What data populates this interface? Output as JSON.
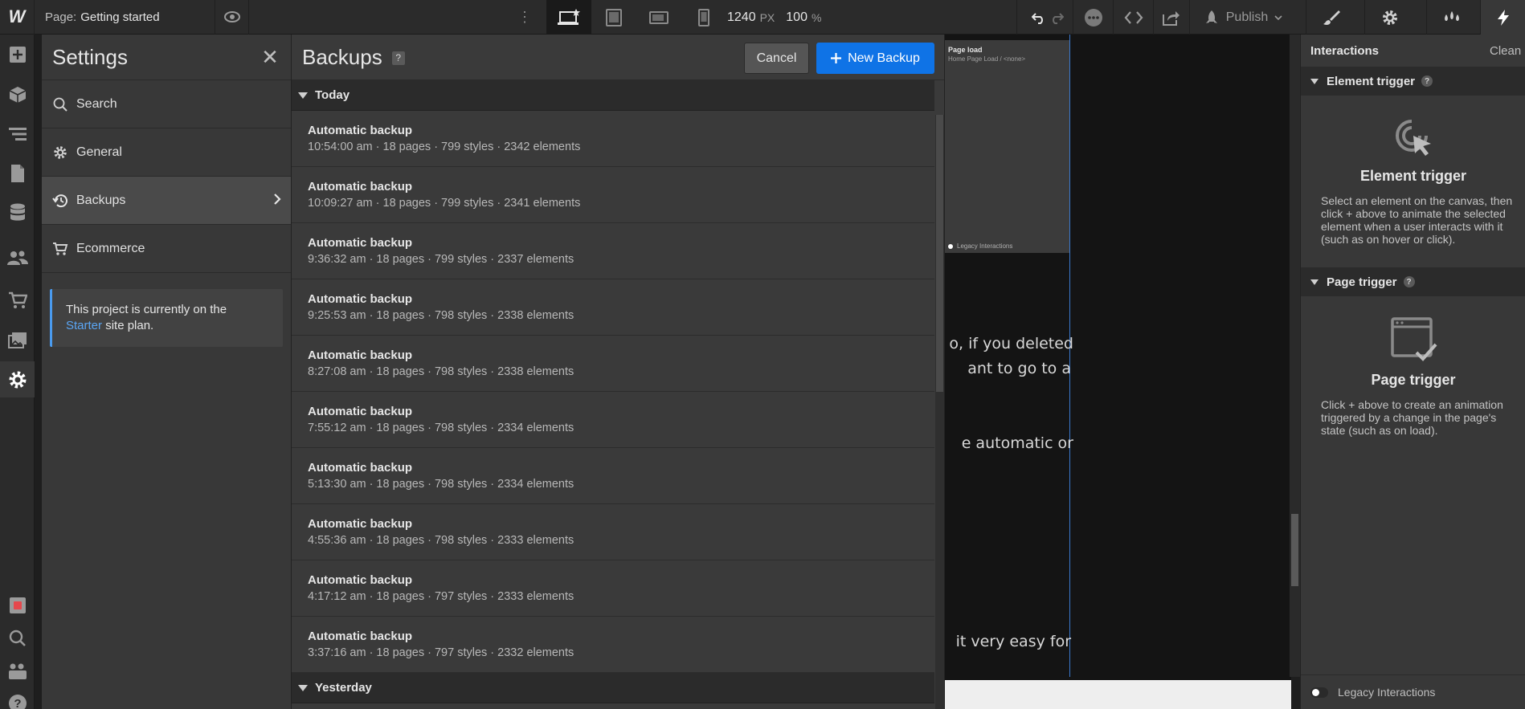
{
  "topbar": {
    "logo": "W",
    "page_label": "Page:",
    "page_name": "Getting started",
    "width_value": "1240",
    "width_unit": "PX",
    "zoom_value": "100",
    "zoom_unit": "%",
    "publish_label": "Publish",
    "accent_active": "#1a1a1a"
  },
  "rail": {
    "items": [
      "add-icon",
      "box-icon",
      "navigator-icon",
      "pages-icon",
      "cms-icon",
      "users-icon",
      "ecommerce-icon",
      "assets-icon",
      "settings-icon"
    ],
    "bottom": [
      "record-icon",
      "search-icon",
      "team-icon",
      "help-icon"
    ]
  },
  "settings": {
    "title": "Settings",
    "items": [
      {
        "label": "Search",
        "icon": "search-icon"
      },
      {
        "label": "General",
        "icon": "gear-icon"
      },
      {
        "label": "Backups",
        "icon": "history-icon"
      },
      {
        "label": "Ecommerce",
        "icon": "cart-icon"
      }
    ],
    "plan_text_1": "This project is currently on the",
    "plan_link": "Starter",
    "plan_text_2": "site plan."
  },
  "backups": {
    "title": "Backups",
    "help": "?",
    "cancel_label": "Cancel",
    "new_label": "New Backup",
    "groups": [
      {
        "label": "Today",
        "rows": [
          {
            "name": "Automatic backup",
            "meta": "10:54:00 am · 18 pages · 799 styles · 2342 elements"
          },
          {
            "name": "Automatic backup",
            "meta": "10:09:27 am · 18 pages · 799 styles · 2341 elements"
          },
          {
            "name": "Automatic backup",
            "meta": "9:36:32 am · 18 pages · 799 styles · 2337 elements"
          },
          {
            "name": "Automatic backup",
            "meta": "9:25:53 am · 18 pages · 798 styles · 2338 elements"
          },
          {
            "name": "Automatic backup",
            "meta": "8:27:08 am · 18 pages · 798 styles · 2338 elements"
          },
          {
            "name": "Automatic backup",
            "meta": "7:55:12 am · 18 pages · 798 styles · 2334 elements"
          },
          {
            "name": "Automatic backup",
            "meta": "5:13:30 am · 18 pages · 798 styles · 2334 elements"
          },
          {
            "name": "Automatic backup",
            "meta": "4:55:36 am · 18 pages · 798 styles · 2333 elements"
          },
          {
            "name": "Automatic backup",
            "meta": "4:17:12 am · 18 pages · 797 styles · 2333 elements"
          },
          {
            "name": "Automatic backup",
            "meta": "3:37:16 am · 18 pages · 797 styles · 2332 elements"
          }
        ]
      },
      {
        "label": "Yesterday",
        "rows": []
      }
    ]
  },
  "canvas": {
    "thumb_title": "Page load",
    "thumb_sub": "Home Page Load / <none>",
    "thumb_legacy": "Legacy Interactions",
    "text_lines": [
      "o, if you deleted",
      "ant to go to a",
      "e automatic or",
      "it very easy for"
    ]
  },
  "interactions": {
    "title": "Interactions",
    "clean_label": "Clean u",
    "element_section": "Element trigger",
    "element_heading": "Element trigger",
    "element_desc": "Select an element on the canvas, then click + above to animate the selected element when a user interacts with it (such as on hover or click).",
    "page_section": "Page trigger",
    "page_heading": "Page trigger",
    "page_desc": "Click + above to create an animation triggered by a change in the page's state (such as on load).",
    "legacy_label": "Legacy Interactions"
  }
}
